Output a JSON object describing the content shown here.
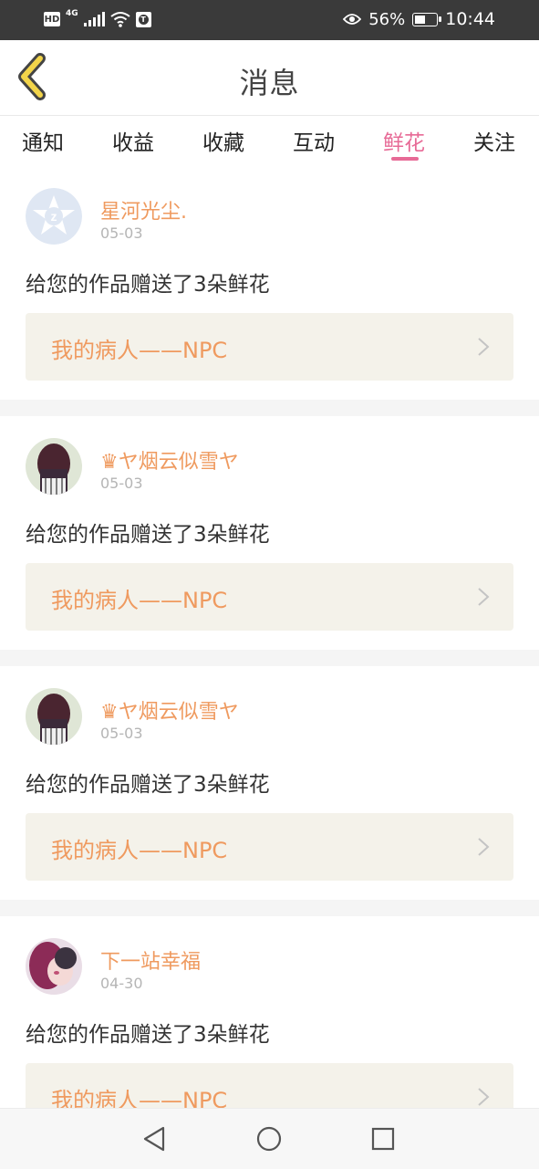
{
  "status_bar": {
    "hd_badge": "HD",
    "network": "4G",
    "battery_percent": "56%",
    "battery_level": 0.56,
    "time": "10:44",
    "icons": [
      "hd-icon",
      "signal-icon",
      "wifi-icon",
      "t-app-icon",
      "eye-icon",
      "battery-icon"
    ]
  },
  "header": {
    "title": "消息",
    "back_icon": "back-chevron-icon",
    "accent_color": "#f2d44a"
  },
  "tabs": [
    {
      "label": "通知",
      "active": false
    },
    {
      "label": "收益",
      "active": false
    },
    {
      "label": "收藏",
      "active": false
    },
    {
      "label": "互动",
      "active": false
    },
    {
      "label": "鲜花",
      "active": true
    },
    {
      "label": "关注",
      "active": false
    }
  ],
  "colors": {
    "active_tab": "#e76a96",
    "username": "#ef9a5f",
    "work_link_bg": "#f4f2ea"
  },
  "items": [
    {
      "username": "星河光尘.",
      "date": "05-03",
      "message": "给您的作品赠送了3朵鲜花",
      "work_title": "我的病人——NPC",
      "avatar": "default-avatar"
    },
    {
      "username": "♛ヤ烟云似雪ヤ",
      "date": "05-03",
      "message": "给您的作品赠送了3朵鲜花",
      "work_title": "我的病人——NPC",
      "avatar": "photo-avatar"
    },
    {
      "username": "♛ヤ烟云似雪ヤ",
      "date": "05-03",
      "message": "给您的作品赠送了3朵鲜花",
      "work_title": "我的病人——NPC",
      "avatar": "photo-avatar"
    },
    {
      "username": "下一站幸福",
      "date": "04-30",
      "message": "给您的作品赠送了3朵鲜花",
      "work_title": "我的病人——NPC",
      "avatar": "anime-avatar"
    }
  ],
  "nav": [
    "back-triangle-icon",
    "home-circle-icon",
    "recents-square-icon"
  ]
}
